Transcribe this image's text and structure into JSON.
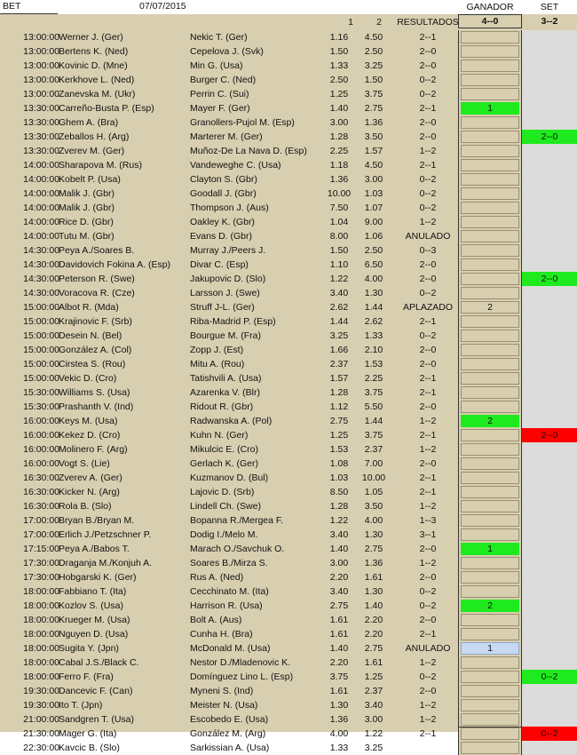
{
  "header": {
    "bet_label": "BET",
    "date": "07/07/2015",
    "ganador_label": "GANADOR",
    "set_label": "SET",
    "col_1": "1",
    "col_2": "2",
    "resultados_label": "RESULTADOS",
    "ganador_score": "4--0",
    "set_score": "3--2"
  },
  "colors": {
    "green": "#1fea1f",
    "red": "#ff0000",
    "blue": "#c6d9f1",
    "background": "#d8cfb0"
  },
  "rows": [
    {
      "time": "13:00:00",
      "p1": "Werner J. (Ger)",
      "p2": "Nekic T. (Ger)",
      "o1": "1.16",
      "o2": "4.50",
      "res": "2--1",
      "gan": "",
      "gan_style": "",
      "set": "",
      "set_style": ""
    },
    {
      "time": "13:00:00",
      "p1": "Bertens K. (Ned)",
      "p2": "Cepelova J. (Svk)",
      "o1": "1.50",
      "o2": "2.50",
      "res": "2--0",
      "gan": "",
      "gan_style": "",
      "set": "",
      "set_style": ""
    },
    {
      "time": "13:00:00",
      "p1": "Kovinic D. (Mne)",
      "p2": "Min G. (Usa)",
      "o1": "1.33",
      "o2": "3.25",
      "res": "2--0",
      "gan": "",
      "gan_style": "",
      "set": "",
      "set_style": ""
    },
    {
      "time": "13:00:00",
      "p1": "Kerkhove L. (Ned)",
      "p2": "Burger C. (Ned)",
      "o1": "2.50",
      "o2": "1.50",
      "res": "0--2",
      "gan": "",
      "gan_style": "",
      "set": "",
      "set_style": ""
    },
    {
      "time": "13:00:00",
      "p1": "Zanevska M. (Ukr)",
      "p2": "Perrin C. (Sui)",
      "o1": "1.25",
      "o2": "3.75",
      "res": "0--2",
      "gan": "",
      "gan_style": "",
      "set": "",
      "set_style": ""
    },
    {
      "time": "13:30:00",
      "p1": "Carreño-Busta P. (Esp)",
      "p2": "Mayer F. (Ger)",
      "o1": "1.40",
      "o2": "2.75",
      "res": "2--1",
      "gan": "1",
      "gan_style": "green",
      "set": "",
      "set_style": ""
    },
    {
      "time": "13:30:00",
      "p1": "Ghem A. (Bra)",
      "p2": "Granollers-Pujol M. (Esp)",
      "o1": "3.00",
      "o2": "1.36",
      "res": "2--0",
      "gan": "",
      "gan_style": "",
      "set": "",
      "set_style": ""
    },
    {
      "time": "13:30:00",
      "p1": "Zeballos H. (Arg)",
      "p2": "Marterer M. (Ger)",
      "o1": "1.28",
      "o2": "3.50",
      "res": "2--0",
      "gan": "",
      "gan_style": "",
      "set": "2--0",
      "set_style": "green"
    },
    {
      "time": "13:30:00",
      "p1": "Zverev M. (Ger)",
      "p2": "Muñoz-De La Nava D. (Esp)",
      "o1": "2.25",
      "o2": "1.57",
      "res": "1--2",
      "gan": "",
      "gan_style": "",
      "set": "",
      "set_style": ""
    },
    {
      "time": "14:00:00",
      "p1": "Sharapova M. (Rus)",
      "p2": "Vandeweghe C. (Usa)",
      "o1": "1.18",
      "o2": "4.50",
      "res": "2--1",
      "gan": "",
      "gan_style": "",
      "set": "",
      "set_style": ""
    },
    {
      "time": "14:00:00",
      "p1": "Kobelt P. (Usa)",
      "p2": "Clayton S. (Gbr)",
      "o1": "1.36",
      "o2": "3.00",
      "res": "0--2",
      "gan": "",
      "gan_style": "",
      "set": "",
      "set_style": ""
    },
    {
      "time": "14:00:00",
      "p1": "Malik J. (Gbr)",
      "p2": "Goodall J. (Gbr)",
      "o1": "10.00",
      "o2": "1.03",
      "res": "0--2",
      "gan": "",
      "gan_style": "",
      "set": "",
      "set_style": ""
    },
    {
      "time": "14:00:00",
      "p1": "Malik J. (Gbr)",
      "p2": "Thompson J. (Aus)",
      "o1": "7.50",
      "o2": "1.07",
      "res": "0--2",
      "gan": "",
      "gan_style": "",
      "set": "",
      "set_style": ""
    },
    {
      "time": "14:00:00",
      "p1": "Rice D. (Gbr)",
      "p2": "Oakley K. (Gbr)",
      "o1": "1.04",
      "o2": "9.00",
      "res": "1--2",
      "gan": "",
      "gan_style": "",
      "set": "",
      "set_style": ""
    },
    {
      "time": "14:00:00",
      "p1": "Tutu M. (Gbr)",
      "p2": "Evans D. (Gbr)",
      "o1": "8.00",
      "o2": "1.06",
      "res": "ANULADO",
      "gan": "",
      "gan_style": "",
      "set": "",
      "set_style": ""
    },
    {
      "time": "14:30:00",
      "p1": "Peya A./Soares B.",
      "p2": "Murray J./Peers J.",
      "o1": "1.50",
      "o2": "2.50",
      "res": "0--3",
      "gan": "",
      "gan_style": "",
      "set": "",
      "set_style": ""
    },
    {
      "time": "14:30:00",
      "p1": "Davidovich Fokina A. (Esp)",
      "p2": "Divar C. (Esp)",
      "o1": "1.10",
      "o2": "6.50",
      "res": "2--0",
      "gan": "",
      "gan_style": "",
      "set": "",
      "set_style": ""
    },
    {
      "time": "14:30:00",
      "p1": "Peterson R. (Swe)",
      "p2": "Jakupovic D. (Slo)",
      "o1": "1.22",
      "o2": "4.00",
      "res": "2--0",
      "gan": "",
      "gan_style": "",
      "set": "2--0",
      "set_style": "green"
    },
    {
      "time": "14:30:00",
      "p1": "Voracova R. (Cze)",
      "p2": "Larsson J. (Swe)",
      "o1": "3.40",
      "o2": "1.30",
      "res": "0--2",
      "gan": "",
      "gan_style": "",
      "set": "",
      "set_style": ""
    },
    {
      "time": "15:00:00",
      "p1": "Albot R. (Mda)",
      "p2": "Struff J-L. (Ger)",
      "o1": "2.62",
      "o2": "1.44",
      "res": "APLAZADO",
      "gan": "2",
      "gan_style": "plain",
      "set": "",
      "set_style": ""
    },
    {
      "time": "15:00:00",
      "p1": "Krajinovic F. (Srb)",
      "p2": "Riba-Madrid P. (Esp)",
      "o1": "1.44",
      "o2": "2.62",
      "res": "2--1",
      "gan": "",
      "gan_style": "",
      "set": "",
      "set_style": ""
    },
    {
      "time": "15:00:00",
      "p1": "Desein N. (Bel)",
      "p2": "Bourgue M. (Fra)",
      "o1": "3.25",
      "o2": "1.33",
      "res": "0--2",
      "gan": "",
      "gan_style": "",
      "set": "",
      "set_style": ""
    },
    {
      "time": "15:00:00",
      "p1": "González A. (Col)",
      "p2": "Zopp J. (Est)",
      "o1": "1.66",
      "o2": "2.10",
      "res": "2--0",
      "gan": "",
      "gan_style": "",
      "set": "",
      "set_style": ""
    },
    {
      "time": "15:00:00",
      "p1": "Cirstea S. (Rou)",
      "p2": "Mitu A. (Rou)",
      "o1": "2.37",
      "o2": "1.53",
      "res": "2--0",
      "gan": "",
      "gan_style": "",
      "set": "",
      "set_style": ""
    },
    {
      "time": "15:00:00",
      "p1": "Vekic D. (Cro)",
      "p2": "Tatishvili A. (Usa)",
      "o1": "1.57",
      "o2": "2.25",
      "res": "2--1",
      "gan": "",
      "gan_style": "",
      "set": "",
      "set_style": ""
    },
    {
      "time": "15:30:00",
      "p1": "Williams S. (Usa)",
      "p2": "Azarenka V. (Blr)",
      "o1": "1.28",
      "o2": "3.75",
      "res": "2--1",
      "gan": "",
      "gan_style": "",
      "set": "",
      "set_style": ""
    },
    {
      "time": "15:30:00",
      "p1": "Prashanth V. (Ind)",
      "p2": "Ridout R. (Gbr)",
      "o1": "1.12",
      "o2": "5.50",
      "res": "2--0",
      "gan": "",
      "gan_style": "",
      "set": "",
      "set_style": ""
    },
    {
      "time": "16:00:00",
      "p1": "Keys M. (Usa)",
      "p2": "Radwanska A. (Pol)",
      "o1": "2.75",
      "o2": "1.44",
      "res": "1--2",
      "gan": "2",
      "gan_style": "green",
      "set": "",
      "set_style": ""
    },
    {
      "time": "16:00:00",
      "p1": "Kekez D. (Cro)",
      "p2": "Kuhn N. (Ger)",
      "o1": "1.25",
      "o2": "3.75",
      "res": "2--1",
      "gan": "",
      "gan_style": "",
      "set": "2--0",
      "set_style": "red"
    },
    {
      "time": "16:00:00",
      "p1": "Molinero F. (Arg)",
      "p2": "Mikulcic E. (Cro)",
      "o1": "1.53",
      "o2": "2.37",
      "res": "1--2",
      "gan": "",
      "gan_style": "",
      "set": "",
      "set_style": ""
    },
    {
      "time": "16:00:00",
      "p1": "Vogt S. (Lie)",
      "p2": "Gerlach K. (Ger)",
      "o1": "1.08",
      "o2": "7.00",
      "res": "2--0",
      "gan": "",
      "gan_style": "",
      "set": "",
      "set_style": ""
    },
    {
      "time": "16:30:00",
      "p1": "Zverev A. (Ger)",
      "p2": "Kuzmanov D. (Bul)",
      "o1": "1.03",
      "o2": "10.00",
      "res": "2--1",
      "gan": "",
      "gan_style": "",
      "set": "",
      "set_style": ""
    },
    {
      "time": "16:30:00",
      "p1": "Kicker N. (Arg)",
      "p2": "Lajovic D. (Srb)",
      "o1": "8.50",
      "o2": "1.05",
      "res": "2--1",
      "gan": "",
      "gan_style": "",
      "set": "",
      "set_style": ""
    },
    {
      "time": "16:30:00",
      "p1": "Rola B. (Slo)",
      "p2": "Lindell Ch. (Swe)",
      "o1": "1.28",
      "o2": "3.50",
      "res": "1--2",
      "gan": "",
      "gan_style": "",
      "set": "",
      "set_style": ""
    },
    {
      "time": "17:00:00",
      "p1": "Bryan B./Bryan M.",
      "p2": "Bopanna R./Mergea F.",
      "o1": "1.22",
      "o2": "4.00",
      "res": "1--3",
      "gan": "",
      "gan_style": "",
      "set": "",
      "set_style": ""
    },
    {
      "time": "17:00:00",
      "p1": "Erlich J./Petzschner P.",
      "p2": "Dodig I./Melo M.",
      "o1": "3.40",
      "o2": "1.30",
      "res": "3--1",
      "gan": "",
      "gan_style": "",
      "set": "",
      "set_style": ""
    },
    {
      "time": "17:15:00",
      "p1": "Peya A./Babos T.",
      "p2": "Marach O./Savchuk O.",
      "o1": "1.40",
      "o2": "2.75",
      "res": "2--0",
      "gan": "1",
      "gan_style": "green",
      "set": "",
      "set_style": ""
    },
    {
      "time": "17:30:00",
      "p1": "Draganja M./Konjuh A.",
      "p2": "Soares B./Mirza S.",
      "o1": "3.00",
      "o2": "1.36",
      "res": "1--2",
      "gan": "",
      "gan_style": "",
      "set": "",
      "set_style": ""
    },
    {
      "time": "17:30:00",
      "p1": "Hobgarski K. (Ger)",
      "p2": "Rus A. (Ned)",
      "o1": "2.20",
      "o2": "1.61",
      "res": "2--0",
      "gan": "",
      "gan_style": "",
      "set": "",
      "set_style": ""
    },
    {
      "time": "18:00:00",
      "p1": "Fabbiano T. (Ita)",
      "p2": "Cecchinato M. (Ita)",
      "o1": "3.40",
      "o2": "1.30",
      "res": "0--2",
      "gan": "",
      "gan_style": "",
      "set": "",
      "set_style": ""
    },
    {
      "time": "18:00:00",
      "p1": "Kozlov S. (Usa)",
      "p2": "Harrison R. (Usa)",
      "o1": "2.75",
      "o2": "1.40",
      "res": "0--2",
      "gan": "2",
      "gan_style": "green",
      "set": "",
      "set_style": ""
    },
    {
      "time": "18:00:00",
      "p1": "Krueger M. (Usa)",
      "p2": "Bolt A. (Aus)",
      "o1": "1.61",
      "o2": "2.20",
      "res": "2--0",
      "gan": "",
      "gan_style": "",
      "set": "",
      "set_style": ""
    },
    {
      "time": "18:00:00",
      "p1": "Nguyen D. (Usa)",
      "p2": "Cunha H. (Bra)",
      "o1": "1.61",
      "o2": "2.20",
      "res": "2--1",
      "gan": "",
      "gan_style": "",
      "set": "",
      "set_style": ""
    },
    {
      "time": "18:00:00",
      "p1": "Sugita Y. (Jpn)",
      "p2": "McDonald M. (Usa)",
      "o1": "1.40",
      "o2": "2.75",
      "res": "ANULADO",
      "gan": "1",
      "gan_style": "blue",
      "set": "",
      "set_style": ""
    },
    {
      "time": "18:00:00",
      "p1": "Cabal J.S./Black C.",
      "p2": "Nestor D./Mladenovic K.",
      "o1": "2.20",
      "o2": "1.61",
      "res": "1--2",
      "gan": "",
      "gan_style": "",
      "set": "",
      "set_style": ""
    },
    {
      "time": "18:00:00",
      "p1": "Ferro F. (Fra)",
      "p2": "Domínguez Lino L. (Esp)",
      "o1": "3.75",
      "o2": "1.25",
      "res": "0--2",
      "gan": "",
      "gan_style": "",
      "set": "0--2",
      "set_style": "green"
    },
    {
      "time": "19:30:00",
      "p1": "Dancevic F. (Can)",
      "p2": "Myneni S. (Ind)",
      "o1": "1.61",
      "o2": "2.37",
      "res": "2--0",
      "gan": "",
      "gan_style": "",
      "set": "",
      "set_style": ""
    },
    {
      "time": "19:30:00",
      "p1": "Ito T. (Jpn)",
      "p2": "Meister N. (Usa)",
      "o1": "1.30",
      "o2": "3.40",
      "res": "1--2",
      "gan": "",
      "gan_style": "",
      "set": "",
      "set_style": ""
    },
    {
      "time": "21:00:00",
      "p1": "Sandgren T. (Usa)",
      "p2": "Escobedo E. (Usa)",
      "o1": "1.36",
      "o2": "3.00",
      "res": "1--2",
      "gan": "",
      "gan_style": "",
      "set": "",
      "set_style": ""
    },
    {
      "time": "21:30:00",
      "p1": "Mager G. (Ita)",
      "p2": "González M. (Arg)",
      "o1": "4.00",
      "o2": "1.22",
      "res": "2--1",
      "gan": "",
      "gan_style": "",
      "set": "0--2",
      "set_style": "red"
    },
    {
      "time": "22:30:00",
      "p1": "Kavcic B. (Slo)",
      "p2": "Sarkissian A. (Usa)",
      "o1": "1.33",
      "o2": "3.25",
      "res": "",
      "gan": "",
      "gan_style": "",
      "set": "",
      "set_style": ""
    }
  ]
}
